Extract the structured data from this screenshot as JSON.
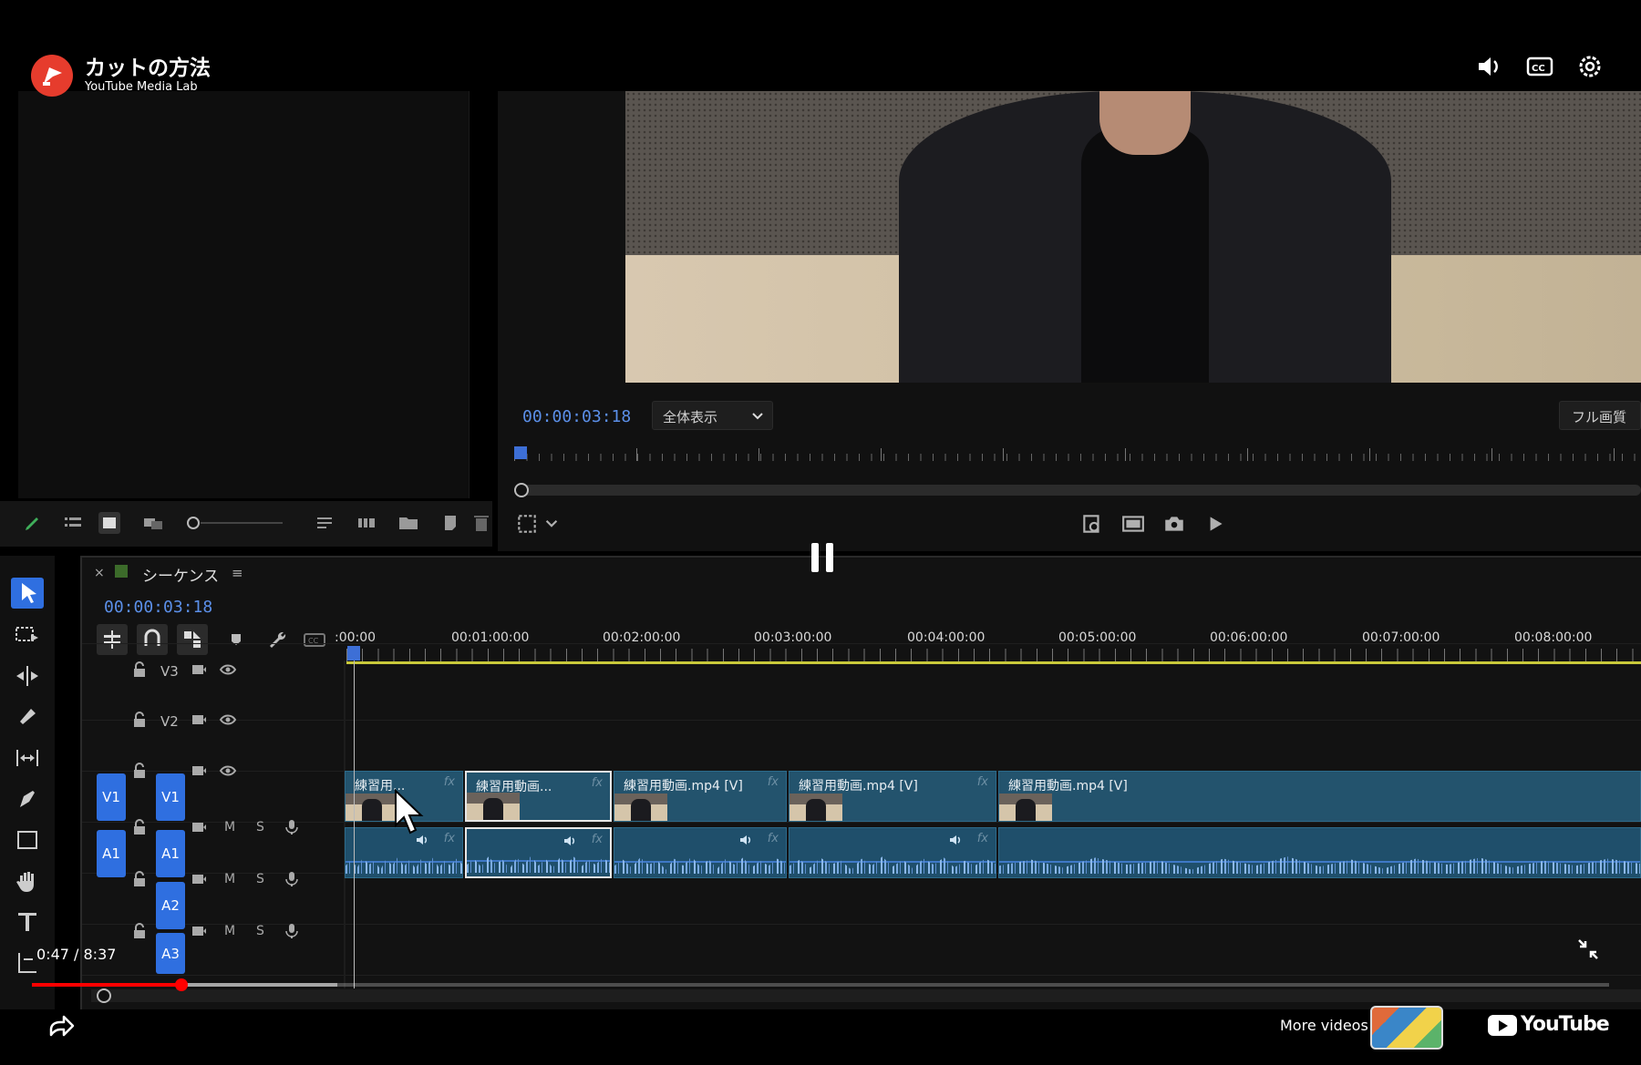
{
  "youtube": {
    "title": "カットの方法",
    "channel": "YouTube Media Lab",
    "current_time": "0:47",
    "separator": " / ",
    "duration": "8:37",
    "progress_fraction": 0.091,
    "more_videos": "More videos",
    "logo_text": "YouTube"
  },
  "program_monitor": {
    "timecode": "00:00:03:18",
    "fit_dropdown": "全体表示",
    "quality": "フル画質"
  },
  "timeline": {
    "close": "×",
    "sequence_name": "シーケンス",
    "menu": "≡",
    "timecode": "00:00:03:18",
    "ruler": [
      ":00:00",
      "00:01:00:00",
      "00:02:00:00",
      "00:03:00:00",
      "00:04:00:00",
      "00:05:00:00",
      "00:06:00:00",
      "00:07:00:00",
      "00:08:00:00"
    ],
    "tracks": {
      "v3": "V3",
      "v2": "V2",
      "v1_src": "V1",
      "v1": "V1",
      "a1_src": "A1",
      "a1": "A1",
      "a2": "A2",
      "a3": "A3",
      "mute": "M",
      "solo": "S"
    },
    "video_clips": [
      "練習用...",
      "練習用動画...",
      "練習用動画.mp4 [V]",
      "練習用動画.mp4 [V]",
      "練習用動画.mp4 [V]"
    ],
    "fx": "fx"
  },
  "colors": {
    "accent_blue": "#2f6fe0",
    "timecode_blue": "#5b8fe8",
    "clip_video": "#23536d",
    "work_area": "#c9c93a",
    "youtube_red": "#ff0000"
  }
}
